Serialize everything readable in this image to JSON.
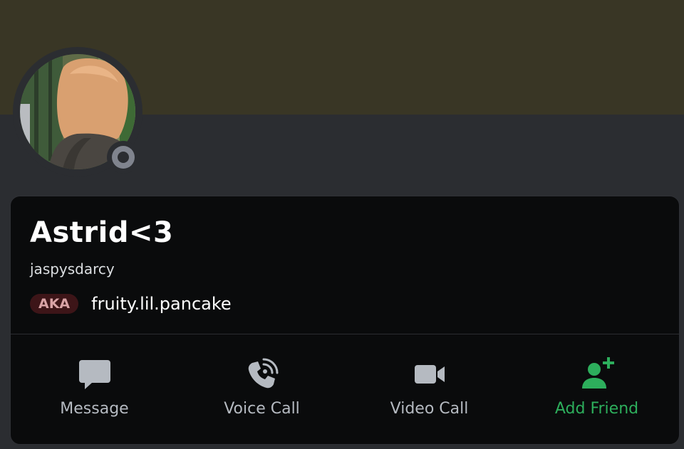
{
  "profile": {
    "display_name": "Astrid<3",
    "username": "jaspysdarcy",
    "aka_label": "AKA",
    "aka_name": "fruity.lil.pancake",
    "status": "offline"
  },
  "colors": {
    "banner": "#393625",
    "background": "#2b2d31",
    "card": "#0a0b0c",
    "action_text": "#b5bac1",
    "add_friend": "#2dae5c",
    "aka_badge_bg": "#3d1518",
    "aka_badge_text": "#d9a3a6"
  },
  "actions": [
    {
      "label": "Message",
      "icon": "message-icon"
    },
    {
      "label": "Voice Call",
      "icon": "phone-icon"
    },
    {
      "label": "Video Call",
      "icon": "video-camera-icon"
    },
    {
      "label": "Add Friend",
      "icon": "add-friend-icon"
    }
  ]
}
